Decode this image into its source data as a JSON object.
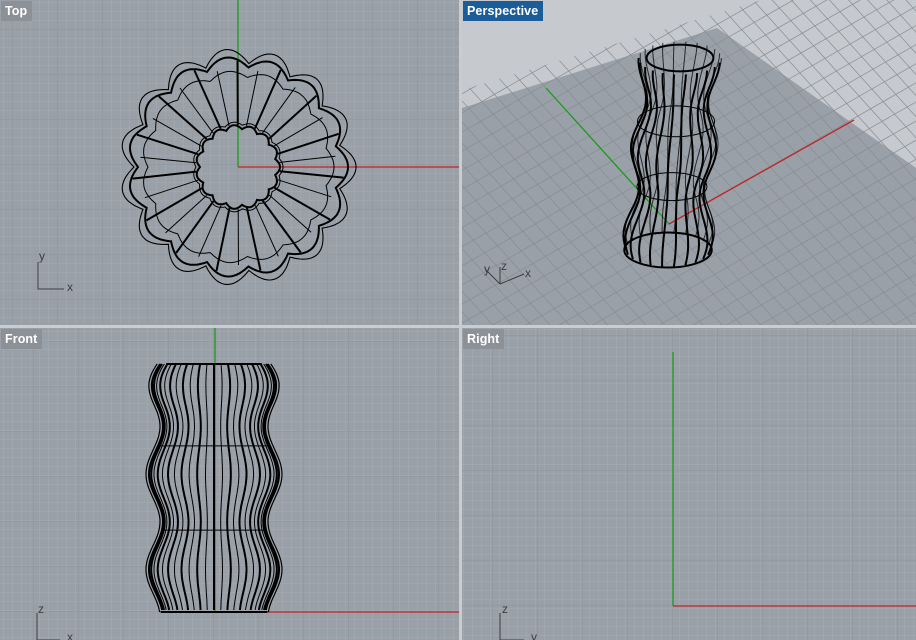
{
  "viewports": [
    {
      "id": "top",
      "title": "Top",
      "active": false,
      "axes": [
        "y",
        "x"
      ]
    },
    {
      "id": "perspective",
      "title": "Perspective",
      "active": true,
      "axes": [
        "y",
        "z",
        "x"
      ]
    },
    {
      "id": "front",
      "title": "Front",
      "active": false,
      "axes": [
        "z",
        "x"
      ]
    },
    {
      "id": "right",
      "title": "Right",
      "active": false,
      "axes": [
        "z",
        "y"
      ]
    }
  ],
  "colors": {
    "viewport_bg": "#9aa0a8",
    "grid_minor": "#a9aeb5",
    "grid_major": "#8d939b",
    "x_axis": "#c02424",
    "y_axis": "#1c9a1c",
    "wire": "#000000",
    "active_label": "#1b5c99",
    "inactive_label": "#8c9097"
  }
}
